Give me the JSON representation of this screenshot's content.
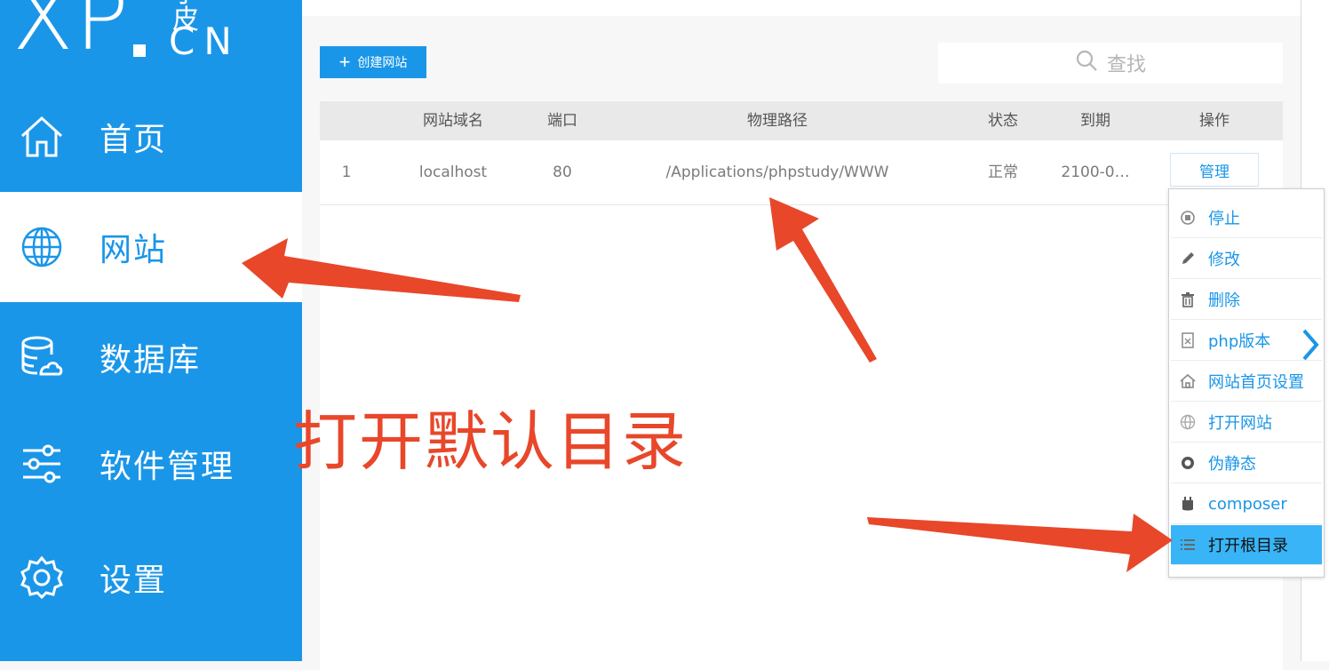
{
  "logo": {
    "text": "XP",
    "domain": "CN",
    "tagline": "小皮"
  },
  "sidebar": {
    "items": [
      {
        "label": "首页",
        "icon": "home-icon"
      },
      {
        "label": "网站",
        "icon": "globe-icon",
        "active": true
      },
      {
        "label": "数据库",
        "icon": "database-icon"
      },
      {
        "label": "软件管理",
        "icon": "sliders-icon"
      },
      {
        "label": "设置",
        "icon": "gear-icon"
      }
    ]
  },
  "toolbar": {
    "create_label": "创建网站",
    "search_placeholder": "查找"
  },
  "table": {
    "headers": [
      "网站域名",
      "端口",
      "物理路径",
      "状态",
      "到期",
      "操作"
    ],
    "rows": [
      {
        "index": "1",
        "domain": "localhost",
        "port": "80",
        "path": "/Applications/phpstudy/WWW",
        "status": "正常",
        "expiry": "2100-0…",
        "action": "管理"
      }
    ]
  },
  "menu": {
    "items": [
      {
        "label": "停止",
        "icon": "stop-icon"
      },
      {
        "label": "修改",
        "icon": "pencil-icon"
      },
      {
        "label": "删除",
        "icon": "trash-icon"
      },
      {
        "label": "php版本",
        "icon": "php-file-icon"
      },
      {
        "label": "网站首页设置",
        "icon": "home-small-icon"
      },
      {
        "label": "打开网站",
        "icon": "globe-small-icon"
      },
      {
        "label": "伪静态",
        "icon": "gear-small-icon"
      },
      {
        "label": "composer",
        "icon": "composer-icon"
      },
      {
        "label": "打开根目录",
        "icon": "list-icon",
        "highlighted": true
      }
    ]
  },
  "annotation": {
    "text": "打开默认目录",
    "color": "#e8472a"
  },
  "colors": {
    "primary": "#1a96e8",
    "highlight": "#39b5f7",
    "arrow": "#e8472a"
  }
}
